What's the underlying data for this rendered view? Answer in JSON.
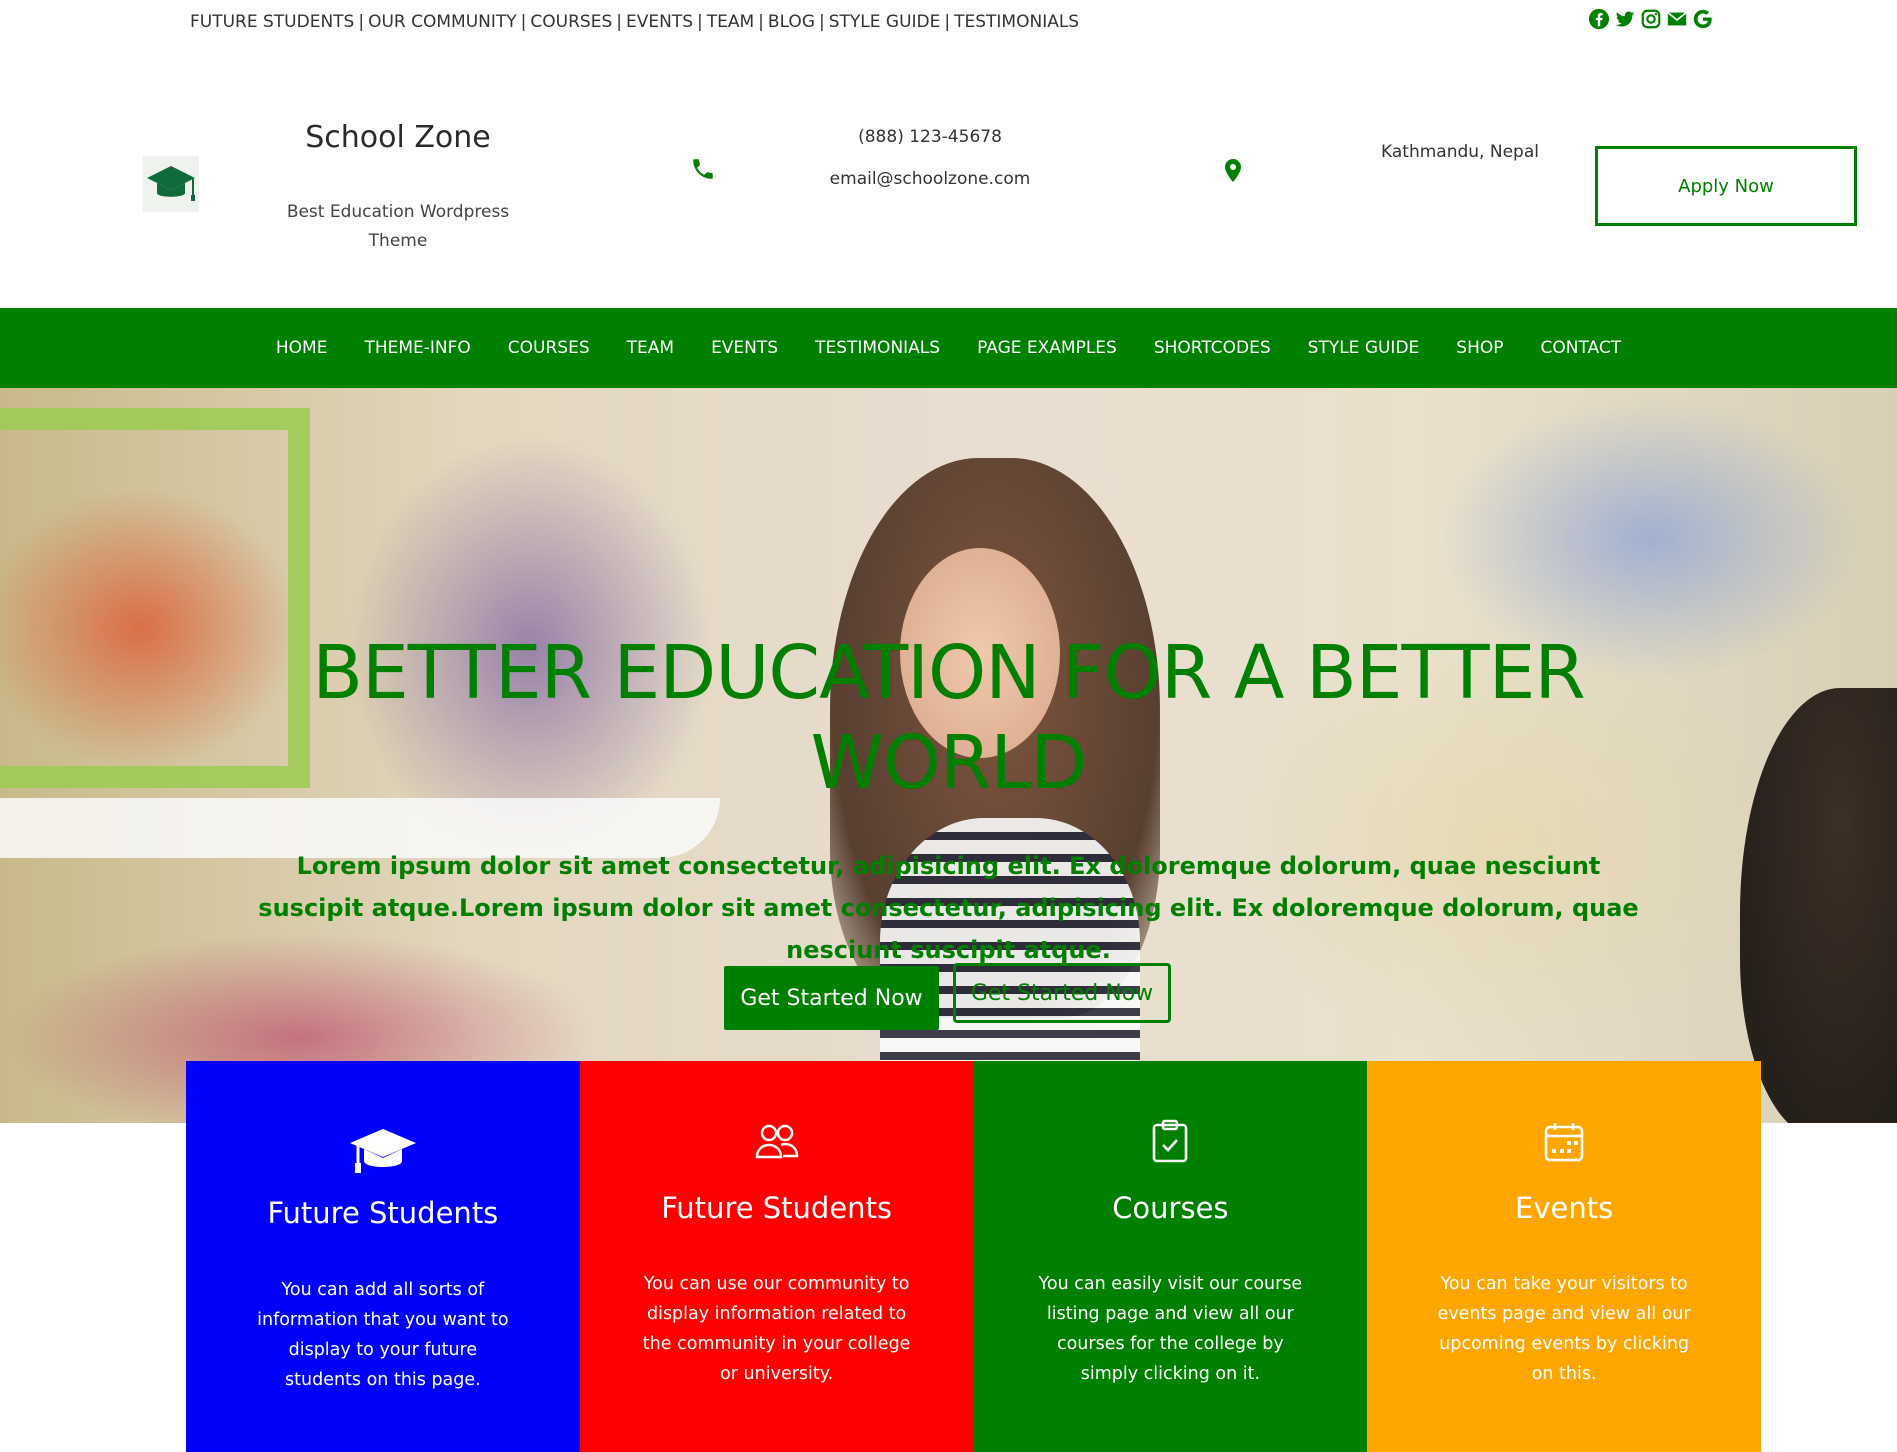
{
  "top_links": [
    "FUTURE STUDENTS",
    "OUR COMMUNITY",
    "COURSES",
    "EVENTS",
    "TEAM",
    "BLOG",
    "STYLE GUIDE",
    "TESTIMONIALS"
  ],
  "social_icons": [
    "facebook-icon",
    "twitter-icon",
    "instagram-icon",
    "mail-icon",
    "google-icon"
  ],
  "header": {
    "site_title": "School Zone",
    "tagline": "Best Education Wordpress Theme",
    "phone": "(888) 123-45678",
    "email": "email@schoolzone.com",
    "address": "Kathmandu, Nepal",
    "apply_label": "Apply Now"
  },
  "nav": [
    "HOME",
    "THEME-INFO",
    "COURSES",
    "TEAM",
    "EVENTS",
    "TESTIMONIALS",
    "PAGE EXAMPLES",
    "SHORTCODES",
    "STYLE GUIDE",
    "SHOP",
    "CONTACT"
  ],
  "hero": {
    "title": "BETTER EDUCATION FOR A BETTER WORLD",
    "text": "Lorem ipsum dolor sit amet consectetur, adipisicing elit. Ex doloremque dolorum, quae nesciunt suscipit atque.Lorem ipsum dolor sit amet consectetur, adipisicing elit. Ex doloremque dolorum, quae nesciunt suscipit atque.",
    "button_primary": "Get Started Now",
    "button_secondary": "Get Started Now"
  },
  "cards": [
    {
      "icon": "graduation-cap-icon",
      "title": "Future Students",
      "text": "You can add all sorts of information that you want to display to your future students on this page.",
      "color": "#0000ff"
    },
    {
      "icon": "users-icon",
      "title": "Future Students",
      "text": "You can use our community to display information related to the community in your college or university.",
      "color": "#ff0000"
    },
    {
      "icon": "clipboard-check-icon",
      "title": "Courses",
      "text": "You can easily visit our course listing page and view all our courses for the college by simply clicking on it.",
      "color": "#008000"
    },
    {
      "icon": "calendar-icon",
      "title": "Events",
      "text": "You can take your visitors to events page and view all our upcoming events by clicking on this.",
      "color": "#ffa500"
    }
  ],
  "colors": {
    "brand_green": "#008000",
    "white": "#ffffff"
  }
}
